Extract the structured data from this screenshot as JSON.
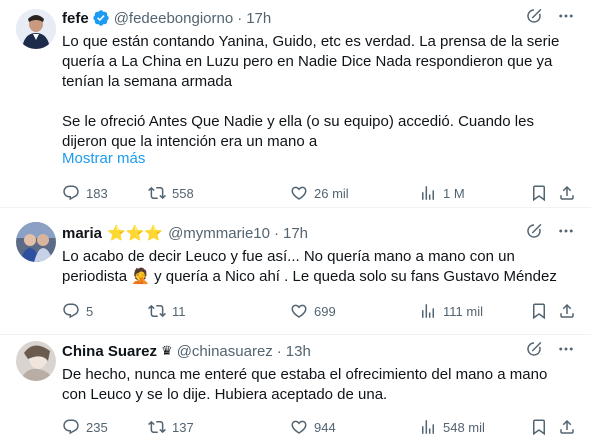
{
  "tweets": [
    {
      "name": "fefe",
      "handle": "@fedeebongiorno",
      "dot": "·",
      "time": "17h",
      "verified": true,
      "text_p1": "Lo que están contando Yanina, Guido, etc es verdad. La prensa de la serie quería a La China en Luzu pero en Nadie Dice Nada respondieron que ya tenían la semana armada",
      "text_p2": "Se le ofreció Antes Que Nadie y ella (o su equipo) accedió. Cuando les dijeron que la intención era un mano a",
      "show_more": "Mostrar más",
      "replies": "183",
      "retweets": "558",
      "likes": "26 mil",
      "views": "1 M"
    },
    {
      "name": "maria",
      "stars": "⭐⭐⭐",
      "handle": "@mymmarie10",
      "dot": "·",
      "time": "17h",
      "text_line1": "Lo acabo de decir Leuco y fue así... No quería mano a mano con un",
      "text_line2a": "periodista",
      "emoji": "🤦",
      "text_line2b": " y quería a Nico ahí . Le queda solo su fans  Gustavo Méndez",
      "replies": "5",
      "retweets": "11",
      "likes": "699",
      "views": "111 mil"
    },
    {
      "name": "China Suarez",
      "crown": "♛",
      "handle": "@chinasuarez",
      "dot": "·",
      "time": "13h",
      "text": "De hecho, nunca me enteré que estaba el ofrecimiento del mano a mano con Leuco y se lo dije. Hubiera aceptado de una.",
      "replies": "235",
      "retweets": "137",
      "likes": "944",
      "views": "548 mil"
    }
  ],
  "colors": {
    "verified": "#1d9bf0",
    "link": "#1d9bf0",
    "muted": "#536471",
    "text": "#0f1419"
  },
  "icons": [
    "grok-icon",
    "more-icon",
    "reply-icon",
    "retweet-icon",
    "like-icon",
    "views-icon",
    "bookmark-icon",
    "share-icon"
  ]
}
